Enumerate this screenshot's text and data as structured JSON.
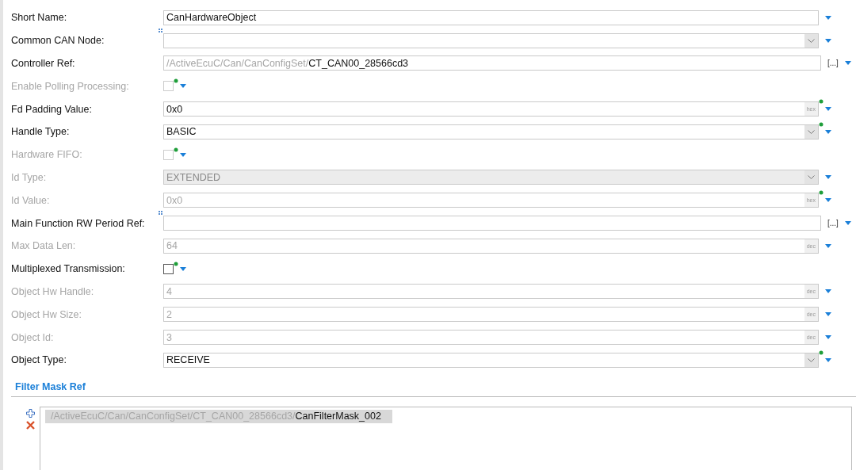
{
  "fields": [
    {
      "label": "Short Name:",
      "kind": "text",
      "disabled": false,
      "value": "CanHardwareObject"
    },
    {
      "label": "Common CAN Node:",
      "kind": "combo",
      "disabled": false,
      "linked": true
    },
    {
      "label": "Controller Ref:",
      "kind": "ref",
      "disabled": false,
      "path": "/ActiveEcuC/Can/CanConfigSet/",
      "value": "CT_CAN00_28566cd3",
      "browse": "[...]"
    },
    {
      "label": "Enable Polling Processing:",
      "kind": "checkbox",
      "disabled": true,
      "checked": false,
      "modified": true
    },
    {
      "label": "Fd Padding Value:",
      "kind": "text",
      "disabled": false,
      "value": "0x0",
      "unit": "hex",
      "modified": true
    },
    {
      "label": "Handle Type:",
      "kind": "combo",
      "disabled": false,
      "value": "BASIC",
      "modified": true
    },
    {
      "label": "Hardware FIFO:",
      "kind": "checkbox",
      "disabled": true,
      "checked": false,
      "modified": true
    },
    {
      "label": "Id Type:",
      "kind": "combo",
      "disabled": true,
      "value": "EXTENDED"
    },
    {
      "label": "Id Value:",
      "kind": "text",
      "disabled": true,
      "value": "0x0",
      "unit": "hex",
      "modified": true
    },
    {
      "label": "Main Function RW Period Ref:",
      "kind": "ref",
      "disabled": false,
      "browse": "[...]",
      "linked": true
    },
    {
      "label": "Max Data Len:",
      "kind": "text",
      "disabled": true,
      "value": "64",
      "unit": "dec"
    },
    {
      "label": "Multiplexed Transmission:",
      "kind": "checkbox",
      "disabled": false,
      "checked": false,
      "modified": true
    },
    {
      "label": "Object Hw Handle:",
      "kind": "text",
      "disabled": true,
      "value": "4",
      "unit": "dec"
    },
    {
      "label": "Object Hw Size:",
      "kind": "text",
      "disabled": true,
      "value": "2",
      "unit": "dec"
    },
    {
      "label": "Object Id:",
      "kind": "text",
      "disabled": true,
      "value": "3",
      "unit": "dec"
    },
    {
      "label": "Object Type:",
      "kind": "combo",
      "disabled": false,
      "value": "RECEIVE",
      "modified": true
    }
  ],
  "filter_mask_ref": {
    "title": "Filter Mask Ref",
    "items": [
      {
        "path": "/ActiveEcuC/Can/CanConfigSet/CT_CAN00_28566cd3/",
        "value": "CanFilterMask_002",
        "selected": true
      }
    ]
  }
}
